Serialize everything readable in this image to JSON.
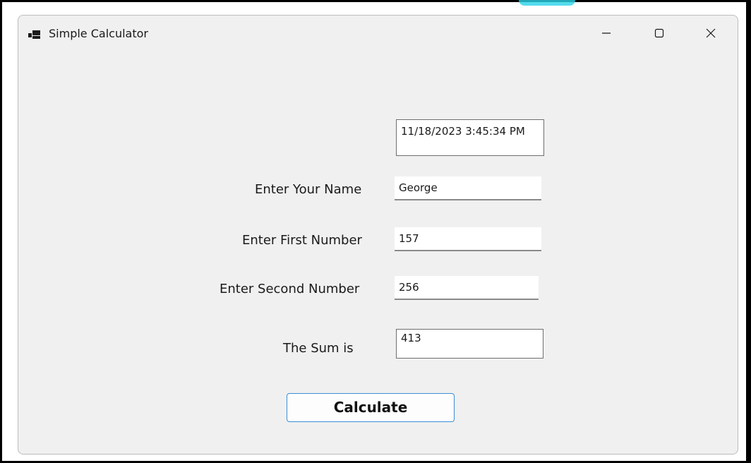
{
  "window": {
    "title": "Simple Calculator",
    "icon": "app-window-icon",
    "controls": {
      "minimize_icon": "minimize-icon",
      "maximize_icon": "maximize-icon",
      "close_icon": "close-icon"
    }
  },
  "form": {
    "datetime_display": "11/18/2023 3:45:34 PM",
    "name_label": "Enter Your Name",
    "name_value": "George",
    "first_label": "Enter First Number",
    "first_value": "157",
    "second_label": "Enter Second Number",
    "second_value": "256",
    "sum_label": "The Sum is",
    "sum_value": "413",
    "calculate_label": "Calculate"
  },
  "colors": {
    "window_bg": "#f0f0f0",
    "button_border": "#3a8ed3",
    "field_bg": "#ffffff"
  }
}
